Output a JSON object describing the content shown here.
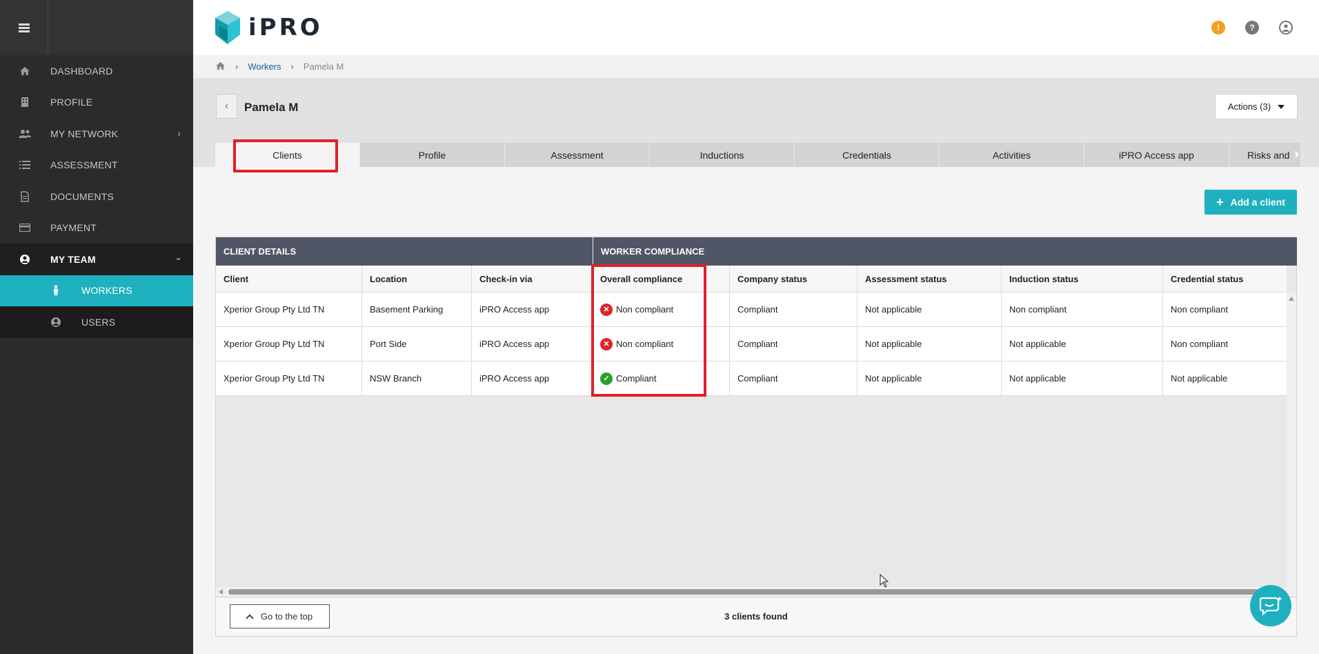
{
  "sidebar": {
    "items": [
      {
        "label": "DASHBOARD",
        "icon": "home-icon"
      },
      {
        "label": "PROFILE",
        "icon": "building-icon"
      },
      {
        "label": "MY NETWORK",
        "icon": "users-icon"
      },
      {
        "label": "ASSESSMENT",
        "icon": "list-icon"
      },
      {
        "label": "DOCUMENTS",
        "icon": "document-icon"
      },
      {
        "label": "PAYMENT",
        "icon": "credit-card-icon"
      },
      {
        "label": "MY TEAM",
        "icon": "user-circle-icon"
      }
    ],
    "sub_items": [
      {
        "label": "WORKERS",
        "icon": "person-icon"
      },
      {
        "label": "USERS",
        "icon": "user-circle-icon"
      }
    ]
  },
  "header": {
    "logo_text": "iPRO",
    "accent": "#1fb0bf"
  },
  "breadcrumb": {
    "items": [
      "Workers",
      "Pamela M"
    ]
  },
  "page": {
    "title": "Pamela M",
    "actions_label": "Actions (3)"
  },
  "tabs": [
    "Clients",
    "Profile",
    "Assessment",
    "Inductions",
    "Credentials",
    "Activities",
    "iPRO Access app",
    "Risks and"
  ],
  "add_button": "Add a client",
  "table": {
    "groups": [
      "CLIENT DETAILS",
      "WORKER COMPLIANCE"
    ],
    "columns": [
      "Client",
      "Location",
      "Check-in via",
      "Overall compliance",
      "Company status",
      "Assessment status",
      "Induction status",
      "Credential status"
    ],
    "rows": [
      [
        "Xperior Group Pty Ltd TN",
        "Basement Parking",
        "iPRO Access app",
        "Non compliant",
        "Compliant",
        "Not applicable",
        "Non compliant",
        "Non compliant"
      ],
      [
        "Xperior Group Pty Ltd TN",
        "Port Side",
        "iPRO Access app",
        "Non compliant",
        "Compliant",
        "Not applicable",
        "Not applicable",
        "Non compliant"
      ],
      [
        "Xperior Group Pty Ltd TN",
        "NSW Branch",
        "iPRO Access app",
        "Compliant",
        "Compliant",
        "Not applicable",
        "Not applicable",
        "Not applicable"
      ]
    ]
  },
  "footer": {
    "top_button": "Go to the top",
    "count_text": "3 clients found"
  },
  "colors": {
    "non_compliant": "#d9262c",
    "compliant": "#2aa02a",
    "highlight": "#e02027"
  }
}
